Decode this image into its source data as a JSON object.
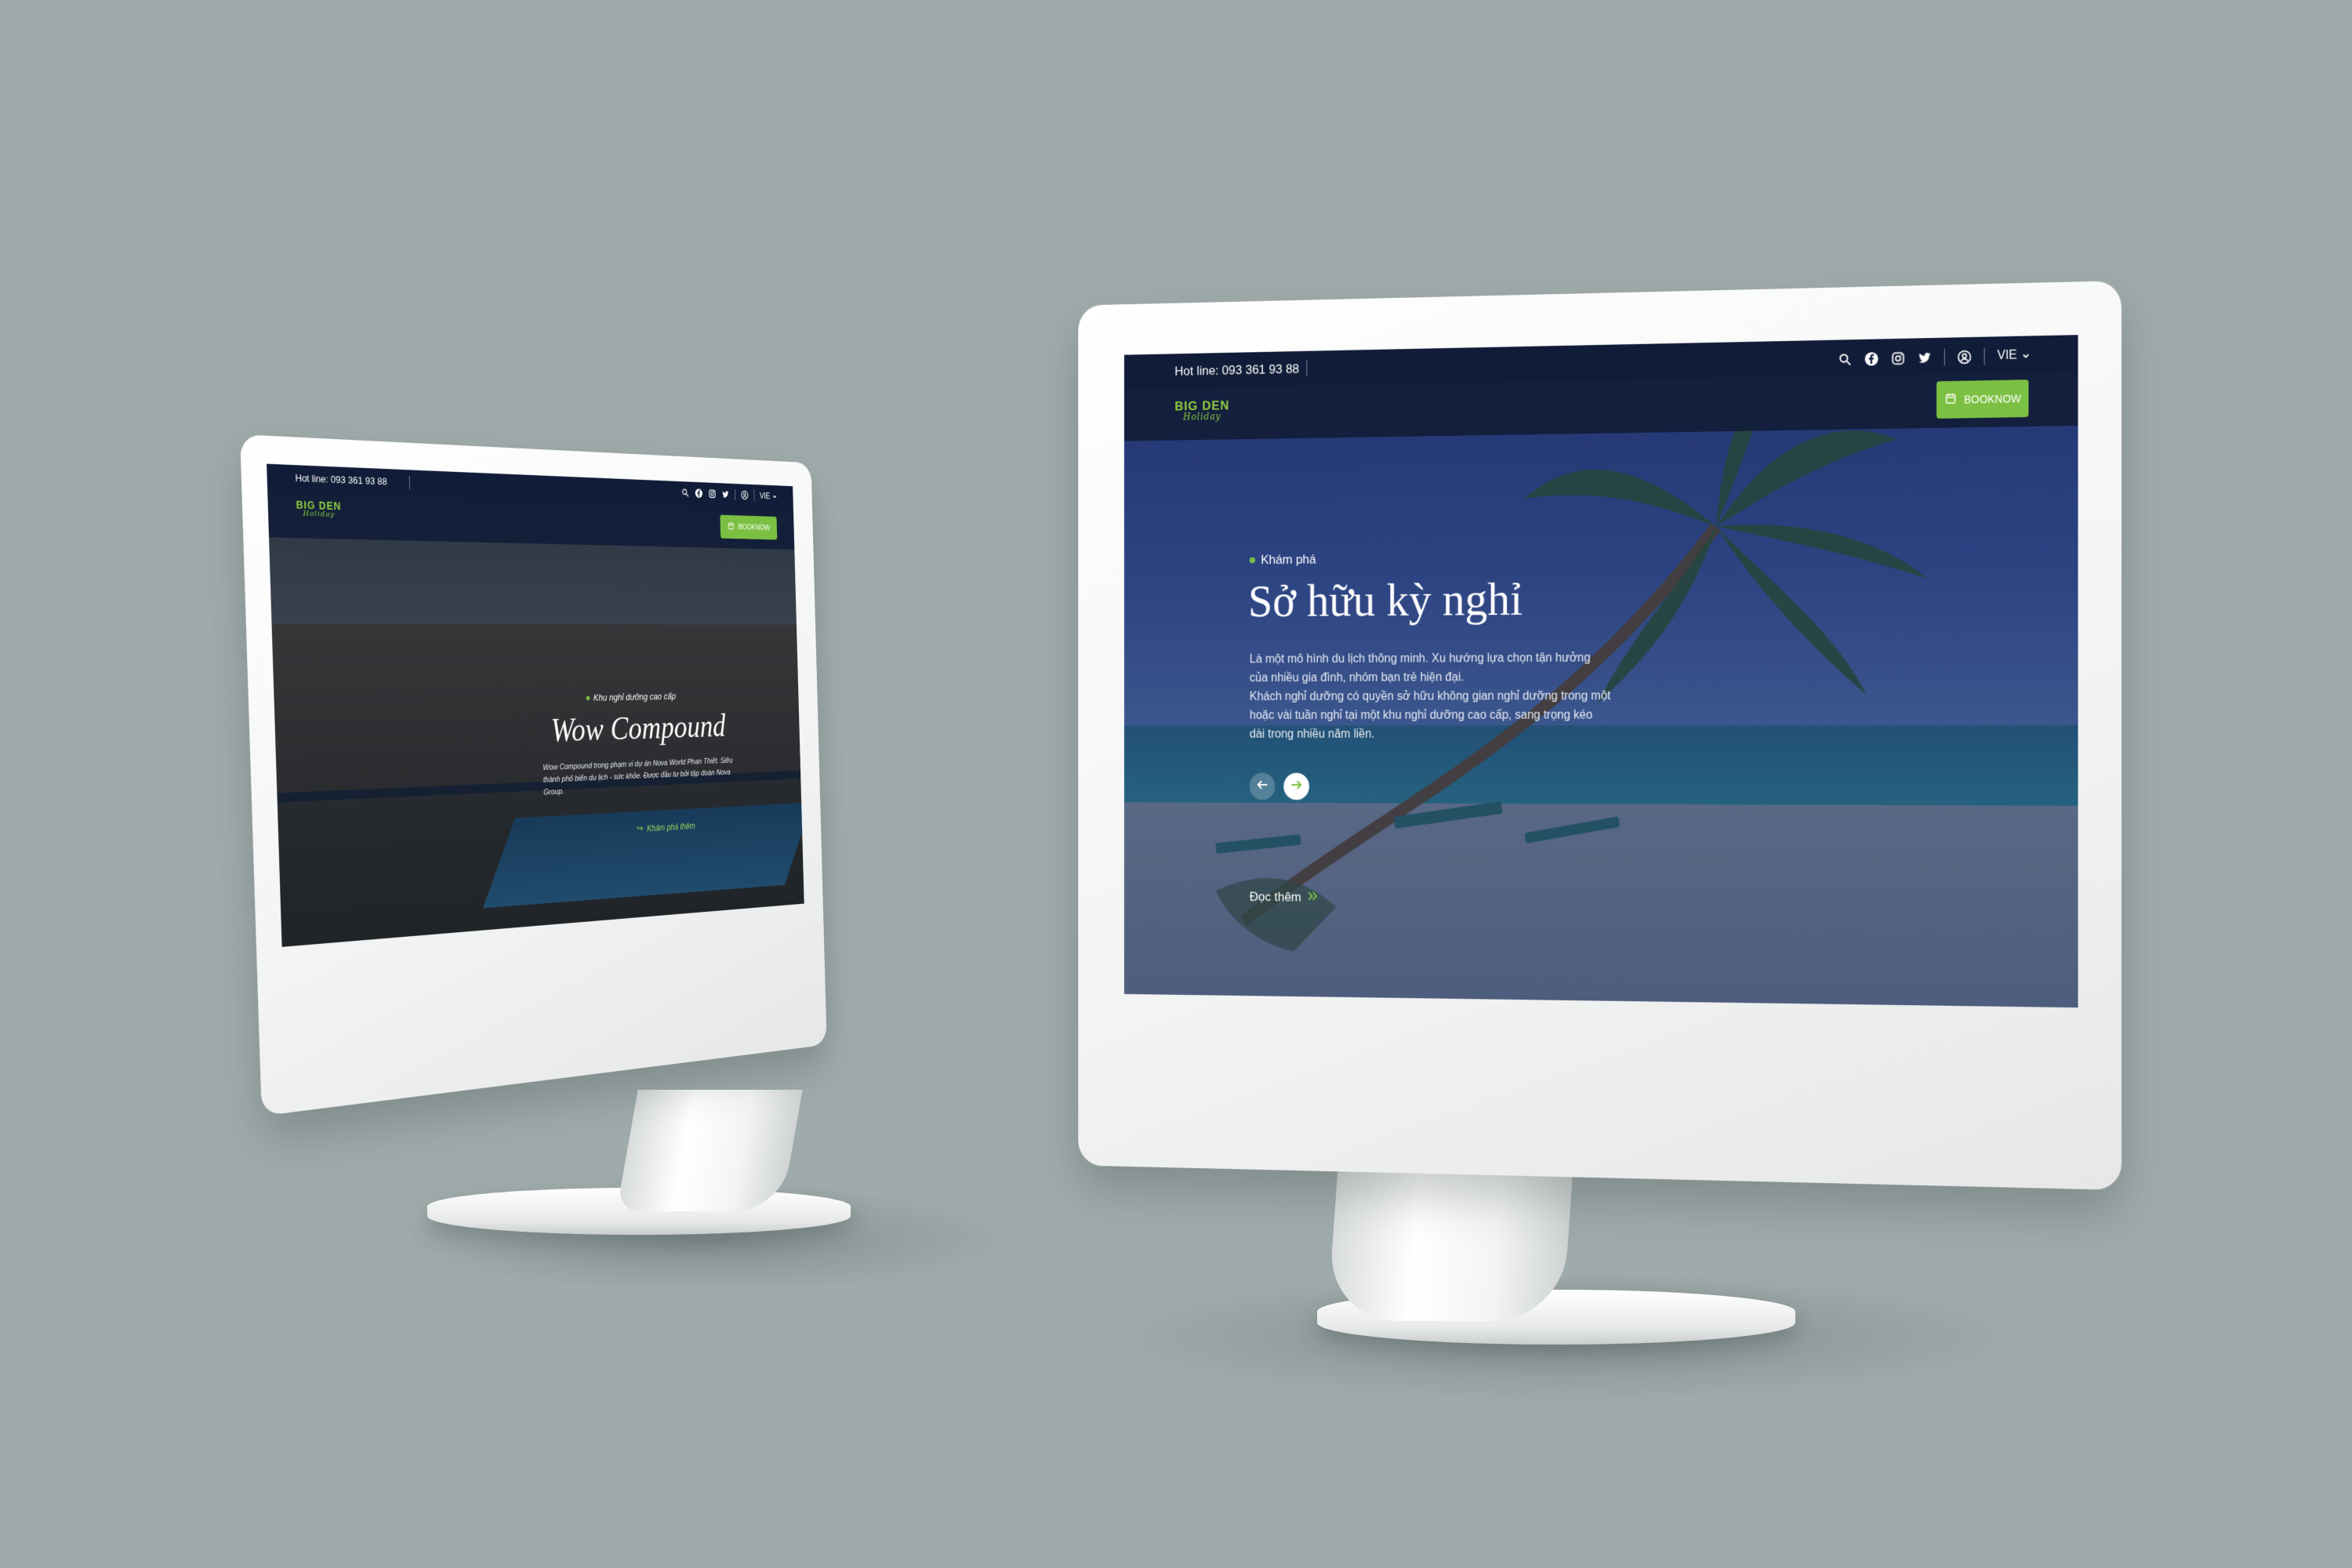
{
  "colors": {
    "background": "#9fabaa",
    "header_navy": "#111d38",
    "accent_green": "#7cc043",
    "monitor_white": "#f4f5f5"
  },
  "left_monitor": {
    "hotline": "Hot line: 093 361 93 88",
    "language": "VIE",
    "book_button": "BOOKNOW",
    "hero": {
      "eyebrow": "Khu nghỉ dưỡng cao cấp",
      "title": "Wow Compound",
      "description": "Wow Compound trong phạm vi dự án Nova World Phan Thiết. Siêu thành phố biển du lịch - sức khỏe. Được đầu tư bởi tập đoàn Nova Group.",
      "cta": "Khám phá thêm"
    },
    "icons": [
      "search-icon",
      "facebook-icon",
      "instagram-icon",
      "twitter-icon",
      "user-icon",
      "chevron-down-icon"
    ]
  },
  "right_monitor": {
    "hotline": "Hot line: 093 361 93 88",
    "language": "VIE",
    "book_button": "BOOKNOW",
    "hero": {
      "eyebrow": "Khám phá",
      "title": "Sở hữu kỳ nghỉ",
      "description_1": "Là một mô hình du lịch thông minh. Xu hướng lựa chọn tận hưởng của nhiều gia đình, nhóm bạn trẻ hiện đại.",
      "description_2": "Khách nghỉ dưỡng có quyền sở hữu không gian nghỉ dưỡng trong một hoặc vài tuần nghỉ tại một khu nghỉ dưỡng cao cấp, sang trọng kéo dài trong nhiều năm liền.",
      "read_more": "Đọc thêm"
    },
    "icons": [
      "search-icon",
      "facebook-icon",
      "instagram-icon",
      "twitter-icon",
      "user-icon",
      "chevron-down-icon",
      "arrow-left-icon",
      "arrow-right-icon",
      "double-chevron-right-icon"
    ]
  }
}
